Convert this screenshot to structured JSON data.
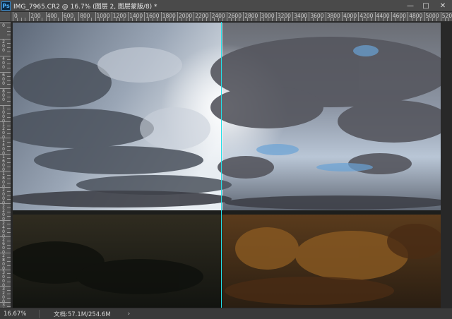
{
  "window": {
    "app_icon": "Ps",
    "title": "IMG_7965.CR2 @ 16.7% (图层 2, 图层蒙版/8) *",
    "controls": [
      "—",
      "□",
      "✕"
    ]
  },
  "ruler_top": {
    "labels": [
      "0",
      "200",
      "400",
      "600",
      "800",
      "1000",
      "1200",
      "1400",
      "1600",
      "1800",
      "2000",
      "2200",
      "2400",
      "2600",
      "2800",
      "3000",
      "3200",
      "3400",
      "3600",
      "3800",
      "4000",
      "4200",
      "4400",
      "4600",
      "4800",
      "5000",
      "5200"
    ]
  },
  "ruler_left": {
    "labels": [
      "0",
      "200",
      "400",
      "600",
      "800",
      "1000",
      "1200",
      "1400",
      "1600",
      "1800",
      "2000",
      "2200",
      "2400",
      "2600",
      "2800",
      "3000",
      "3200",
      "3400"
    ]
  },
  "status": {
    "zoom": "16.67%",
    "doc_info": "文档:57.1M/254.6M",
    "arrow": "›"
  },
  "colors": {
    "guide": "#24e0e8",
    "app_icon_blue": "#2f8ad6"
  }
}
